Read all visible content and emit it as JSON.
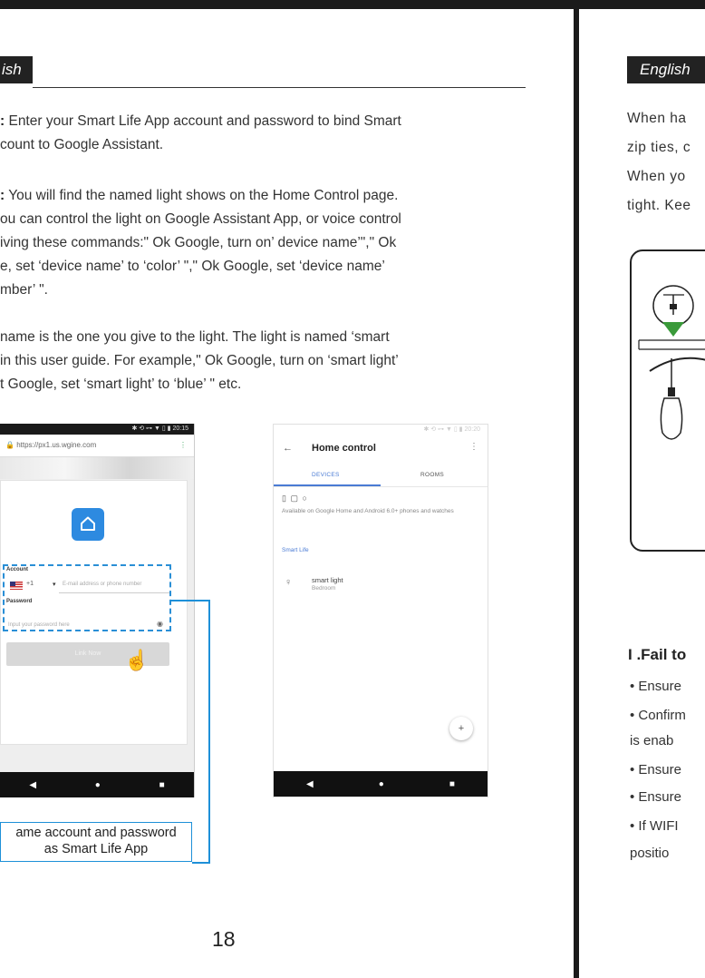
{
  "left_page": {
    "language_tag": "ish",
    "step_paragraph_1": {
      "bold": ":",
      "line1": " Enter your Smart Life App account and password to bind Smart",
      "line2": "count to Google Assistant."
    },
    "step_paragraph_2": {
      "bold": ":",
      "line1": " You will find the named light shows on the Home Control page.",
      "line2": "ou can control the light on Google Assistant App, or voice control",
      "line3": "iving these commands:\" Ok Google, turn on’ device name’\",\" Ok",
      "line4": "e, set  ‘device name’ to ‘color’ \",\" Ok Google, set ‘device name’",
      "line5": "mber’ \"."
    },
    "note_paragraph": {
      "line1": " name is the one you give to the light. The light is named  ‘smart",
      "line2": "in this user guide. For example,\"  Ok Google, turn on   ‘smart light’",
      "line3": "t Google, set   ‘smart light’  to   ‘blue’ \" etc."
    },
    "phone_login": {
      "status_time": "✱ ⟲ ⊶ ▼ ▯ ▮ 20:15",
      "url": "https://px1.us.wgine.com",
      "menu_glyph": "⋮",
      "account_label": "Account",
      "country_code": "+1",
      "dropdown_glyph": "▾",
      "email_placeholder": "E-mail address or phone number",
      "password_label": "Password",
      "password_placeholder": "Input your password here",
      "eye_glyph": "◉",
      "link_button": "Link Now",
      "pointer_glyph": "☝",
      "nav": [
        "◀",
        "●",
        "■"
      ]
    },
    "callout": {
      "line1": "ame account and password",
      "line2": "as Smart Life App"
    },
    "phone_home_control": {
      "status_time": "✱ ⟲ ⊶ ▼ ▯ ▮ 20:20",
      "back_glyph": "←",
      "title": "Home control",
      "menu_glyph": "⋮",
      "tabs": [
        "DEVICES",
        "ROOMS"
      ],
      "device_icons": "▯ ▢ ○",
      "availability": "Available on Google Home and Android 6.0+ phones and watches",
      "section": "Smart Life",
      "bulb_glyph": "♀",
      "device_name": "smart light",
      "device_room": "Bedroom",
      "fab_glyph": "+",
      "nav": [
        "◀",
        "●",
        "■"
      ]
    },
    "page_number": "18"
  },
  "right_page": {
    "language_tag": "English",
    "lines": [
      "When ha",
      "zip ties, c",
      "When yo",
      "tight. Kee"
    ],
    "heading": "I .Fail to",
    "bullets": [
      "• Ensure",
      "• Confirm",
      "  is enab",
      "• Ensure",
      "• Ensure",
      "• If  WIFI",
      "  positio"
    ]
  }
}
